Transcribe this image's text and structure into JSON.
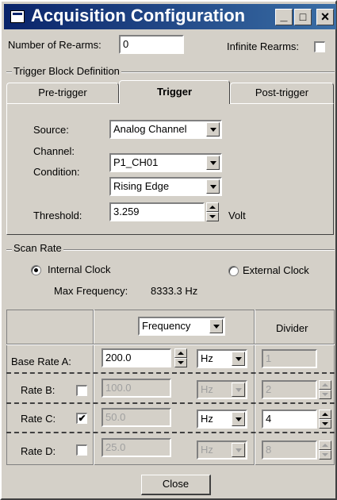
{
  "window": {
    "title": "Acquisition Configuration",
    "minimize": "_",
    "maximize": "□",
    "close": "×"
  },
  "rearms": {
    "label": "Number of Re-arms:",
    "value": "0",
    "infinite_label": "Infinite Rearms:",
    "infinite_checked": false
  },
  "trigger_block": {
    "group_label": "Trigger Block Definition",
    "tabs": [
      {
        "label": "Pre-trigger"
      },
      {
        "label": "Trigger",
        "active": true
      },
      {
        "label": "Post-trigger"
      }
    ],
    "source": {
      "label": "Source:",
      "value": "Analog Channel"
    },
    "channel": {
      "label": "Channel:",
      "value": "P1_CH01"
    },
    "condition": {
      "label": "Condition:",
      "value": "Rising Edge"
    },
    "threshold": {
      "label": "Threshold:",
      "value": "3.259",
      "unit": "Volt"
    }
  },
  "scan_rate": {
    "group_label": "Scan Rate",
    "internal_clock": {
      "label": "Internal Clock",
      "selected": true
    },
    "external_clock": {
      "label": "External Clock",
      "selected": false
    },
    "max_frequency_label": "Max Frequency:",
    "max_frequency_value": "8333.3 Hz",
    "mode_select": "Frequency",
    "divider_header": "Divider",
    "rates": [
      {
        "label": "Base Rate A:",
        "value": "200.0",
        "unit": "Hz",
        "divider": "1",
        "checkbox": null,
        "enabled": true,
        "divider_enabled": false
      },
      {
        "label": "Rate B:",
        "value": "100.0",
        "unit": "Hz",
        "divider": "2",
        "checkbox": false,
        "enabled": false,
        "divider_enabled": false
      },
      {
        "label": "Rate C:",
        "value": "50.0",
        "unit": "Hz",
        "divider": "4",
        "checkbox": true,
        "enabled": false,
        "unit_enabled": true,
        "divider_enabled": true
      },
      {
        "label": "Rate D:",
        "value": "25.0",
        "unit": "Hz",
        "divider": "8",
        "checkbox": false,
        "enabled": false,
        "divider_enabled": false
      }
    ]
  },
  "close_button": "Close",
  "icons": {
    "window": "window-icon",
    "check": "✔"
  }
}
